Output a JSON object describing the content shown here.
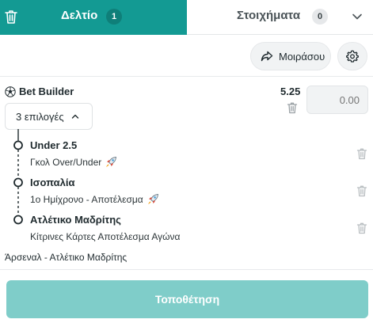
{
  "tabs": {
    "betslip_label": "Δελτίο",
    "betslip_count": "1",
    "bets_label": "Στοιχήματα",
    "bets_count": "0"
  },
  "toolbar": {
    "share_label": "Μοιράσου"
  },
  "bet_builder": {
    "title": "Bet Builder",
    "odds": "5.25",
    "stake_placeholder": "0.00",
    "selections_label": "3 επιλογές"
  },
  "legs": [
    {
      "title": "Under 2.5",
      "market": "Γκολ Over/Under",
      "icon": "rocket-icon"
    },
    {
      "title": "Ισοπαλία",
      "market": "1ο Ημίχρονο - Αποτέλεσμα",
      "icon": "rocket-icon"
    },
    {
      "title": "Ατλέτικο Μαδρίτης",
      "market": "Κίτρινες Κάρτες Αποτέλεσμα Αγώνα"
    }
  ],
  "match": {
    "name": "Άρσεναλ - Ατλέτικο Μαδρίτης"
  },
  "footer": {
    "place_label": "Τοποθέτηση"
  },
  "colors": {
    "accent": "#139a93",
    "accent_dark": "#0f7f79",
    "place_button": "#7fcdc9"
  }
}
